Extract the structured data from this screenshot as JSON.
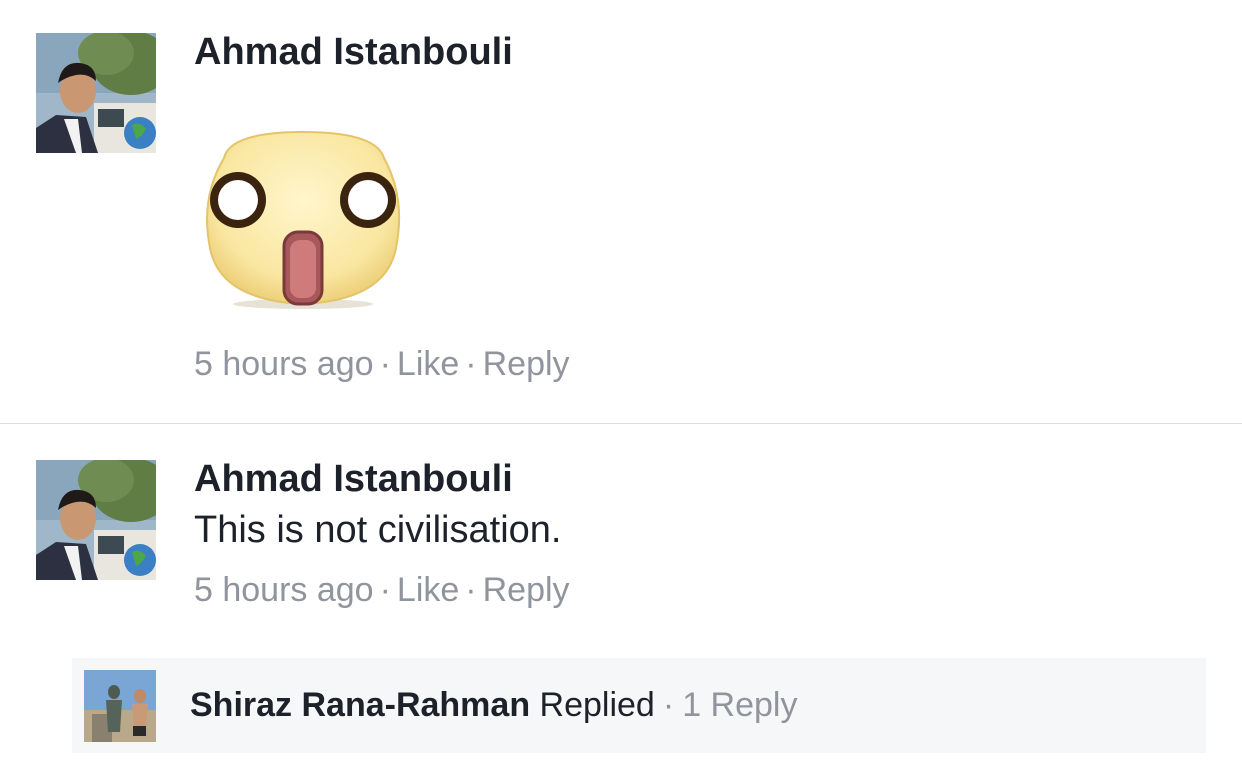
{
  "comments": [
    {
      "author": "Ahmad Istanbouli",
      "sticker": "shocked-face-sticker",
      "time": "5 hours ago",
      "like_label": "Like",
      "reply_label": "Reply"
    },
    {
      "author": "Ahmad Istanbouli",
      "text": "This is not civilisation.",
      "time": "5 hours ago",
      "like_label": "Like",
      "reply_label": "Reply",
      "replies": {
        "name": "Shiraz Rana-Rahman",
        "action": "Replied",
        "count_label": "1 Reply"
      }
    }
  ],
  "separator": "·",
  "colors": {
    "text": "#1d2129",
    "meta": "#90949c",
    "reply_bg": "#f6f7f9",
    "divider": "#dddfe2"
  }
}
